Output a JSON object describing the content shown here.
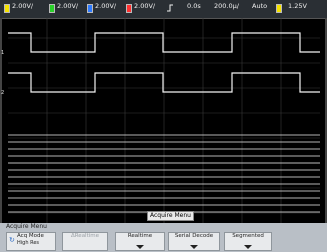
{
  "statusbar": {
    "ch1_scale": "2.00V/",
    "ch2_scale": "2.00V/",
    "ch3_scale": "2.00V/",
    "ch4_scale": "2.00V/",
    "trigger_pos": "0.0s",
    "timebase": "200.0µ/",
    "mode": "Auto",
    "trigger_level": "1.25V"
  },
  "channel_markers": [
    "1",
    "2"
  ],
  "menu": {
    "title": "Acquire Menu",
    "header": "Acquire Menu"
  },
  "softkeys": [
    {
      "label": "Acq Mode",
      "sub": "High Res",
      "icon": "acquire-mode-icon",
      "enabled": true
    },
    {
      "label": "ΔRealtime",
      "sub": "",
      "icon": "",
      "enabled": false
    },
    {
      "label": "Realtime",
      "sub": "",
      "icon": "chevron-down-icon",
      "enabled": true
    },
    {
      "label": "Serial Decode",
      "sub": "",
      "icon": "chevron-down-icon",
      "enabled": true
    },
    {
      "label": "Segmented",
      "sub": "",
      "icon": "chevron-down-icon",
      "enabled": true
    }
  ],
  "colors": {
    "background": "#000000",
    "trace": "#f2f2f2",
    "grid": "#3a3a3a",
    "bar": "#2a2f34",
    "softkey_bg": "#e8eaec"
  }
}
